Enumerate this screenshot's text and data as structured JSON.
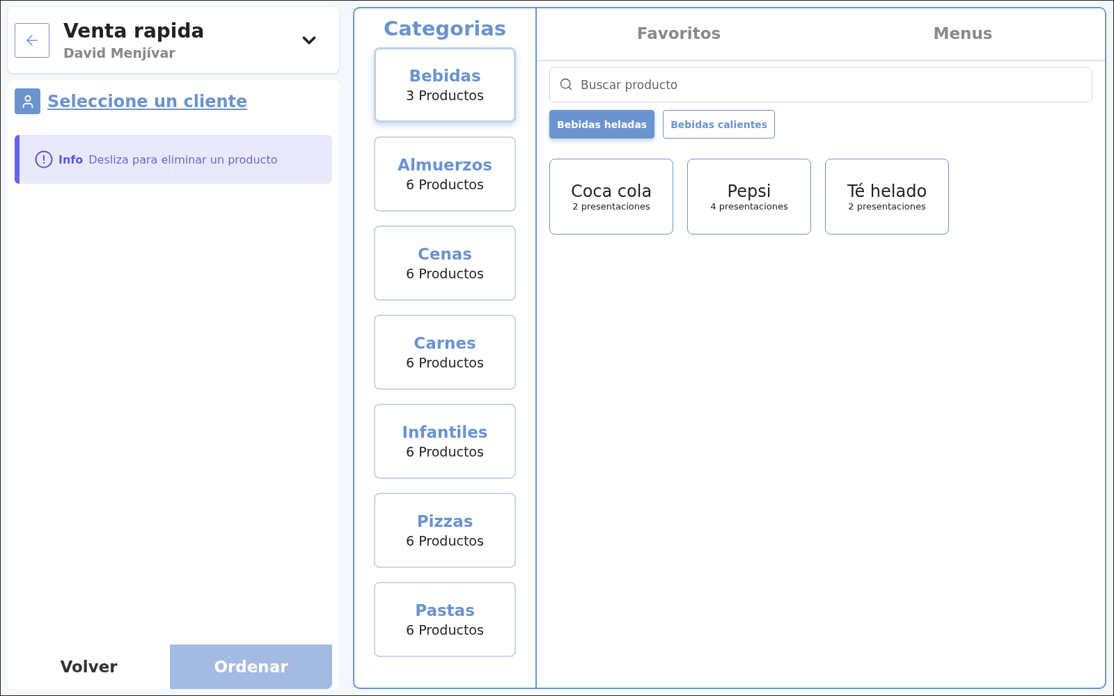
{
  "order": {
    "title": "Venta rapida",
    "subtitle": "David Menjívar"
  },
  "client": {
    "link": "Seleccione un cliente"
  },
  "alert": {
    "label": "Info",
    "message": "Desliza para eliminar un producto"
  },
  "actions": [
    {
      "label": "Volver",
      "disabled": false,
      "kind": "plain"
    },
    {
      "label": "Ordenar",
      "disabled": true,
      "kind": "primary"
    }
  ],
  "categories": {
    "title": "Categorias",
    "items": [
      {
        "name": "Bebidas",
        "count": "3 Productos",
        "selected": true
      },
      {
        "name": "Almuerzos",
        "count": "6 Productos",
        "selected": false
      },
      {
        "name": "Cenas",
        "count": "6 Productos",
        "selected": false
      },
      {
        "name": "Carnes",
        "count": "6 Productos",
        "selected": false
      },
      {
        "name": "Infantiles",
        "count": "6 Productos",
        "selected": false
      },
      {
        "name": "Pizzas",
        "count": "6 Productos",
        "selected": false
      },
      {
        "name": "Pastas",
        "count": "6 Productos",
        "selected": false
      }
    ]
  },
  "tabs": [
    {
      "label": "Favoritos",
      "selected": false
    },
    {
      "label": "Menus",
      "selected": false
    }
  ],
  "search": {
    "placeholder": "Buscar producto"
  },
  "filters": [
    {
      "label": "Bebidas heladas",
      "selected": true
    },
    {
      "label": "Bebidas calientes",
      "selected": false
    }
  ],
  "products": [
    {
      "name": "Coca cola",
      "detail": "2 presentaciones"
    },
    {
      "name": "Pepsi",
      "detail": "4 presentaciones"
    },
    {
      "name": "Té helado",
      "detail": "2 presentaciones"
    }
  ]
}
